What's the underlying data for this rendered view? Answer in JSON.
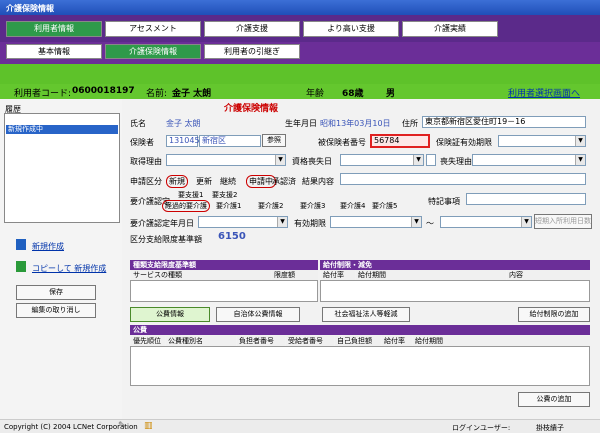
{
  "window": {
    "title": "介護保険情報"
  },
  "tabs_top": [
    {
      "label": "利用者情報"
    },
    {
      "label": "アセスメント"
    },
    {
      "label": "介護支援"
    },
    {
      "label": "より高い支援"
    },
    {
      "label": "介護実績"
    }
  ],
  "tabs_sub": [
    {
      "label": "基本情報"
    },
    {
      "label": "介護保険情報"
    },
    {
      "label": "利用者の引継ぎ"
    }
  ],
  "user": {
    "code_label": "利用者コード:",
    "code": "0600018197",
    "name_label": "名前:",
    "name": "金子 太朗",
    "age_label": "年齢",
    "age": "68歳",
    "sex": "男",
    "switch_link": "利用者選択画面へ"
  },
  "left": {
    "history_label": "履歴",
    "history_item": "新規作成中",
    "new_link": "新規作成",
    "copy_link": "コピーして 新規作成",
    "save_button": "保存",
    "cancel_button": "編集の取り消し"
  },
  "form": {
    "section_title": "介護保険情報",
    "name_label": "氏名",
    "name_value": "金子 太朗",
    "birthday_label": "生年月日",
    "birthday_value": "昭和13年03月10日",
    "address_label": "住所",
    "address_value": "東京都新宿区愛住町19－16",
    "insurer_label": "保険者",
    "insurer_code": "131045",
    "insurer_name": "新宿区",
    "ref_button": "参照",
    "insured_no_label": "被保険者番号",
    "insured_no_value": "56784",
    "valid_period_label": "保険証有効期限",
    "acquire_reason_label": "取得理由",
    "lose_date_label": "資格喪失日",
    "lose_reason_label": "喪失理由",
    "apply_type_label": "申請区分",
    "apply_options": [
      "新規",
      "更新",
      "継続",
      "申請中",
      "承認済"
    ],
    "result_label": "結果内容",
    "care_level_label": "要介護認定",
    "support_levels": [
      "要支援1",
      "要支援2"
    ],
    "care_levels": [
      "経過的要介護",
      "要介護1",
      "要介護2",
      "要介護3",
      "要介護4",
      "要介護5"
    ],
    "special_label": "特記事項",
    "cert_date_label": "要介護認定年月日",
    "valid_label": "有効期限",
    "range_sep": "～",
    "short_stay_button": "短期入所利用日数",
    "limit_label": "区分支給限度基準額",
    "limit_value": "6150"
  },
  "tables": {
    "limit_title": "種類支給限度基準額",
    "limit_cols": [
      "サービスの種類",
      "限度額"
    ],
    "benefit_title": "給付制限・減免",
    "benefit_cols": [
      "給付率",
      "給付期間",
      "内容"
    ],
    "public_title": "公費",
    "public_cols": [
      "優先順位",
      "公費種別名",
      "負担者番号",
      "受給者番号",
      "自己負担額",
      "給付率",
      "給付期間"
    ]
  },
  "buttons": {
    "public_info": "公費情報",
    "local_public": "自治体公費情報",
    "welfare": "社会福祉法人等軽減",
    "add_limit": "給付制限の追加",
    "add_public": "公費の追加"
  },
  "status": {
    "copyright": "Copyright (C) 2004 LCNet Corporation",
    "login_label": "ログインユーザー:",
    "login_user": "掛枝績子"
  }
}
